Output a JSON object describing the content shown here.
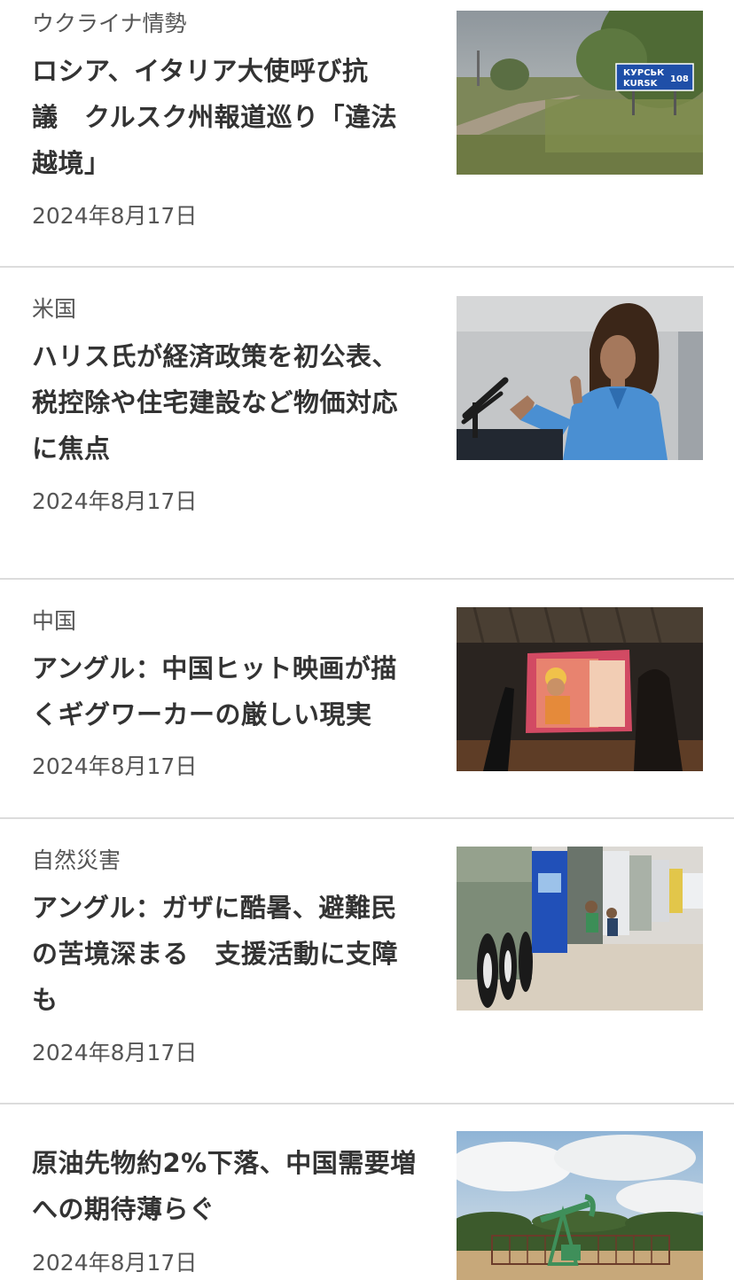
{
  "articles": [
    {
      "category": "ウクライナ情勢",
      "headline_lines": [
        "ロシア、イタリア大使呼び抗",
        "議　クルスク州報道巡り「違法",
        "越境」"
      ],
      "date": "2024年8月17日",
      "image": {
        "sign_line1": "КУРСЬК",
        "sign_line2": "KURSK",
        "sign_number": "108"
      }
    },
    {
      "category": "米国",
      "headline_lines": [
        "ハリス氏が経済政策を初公表、",
        "税控除や住宅建設など物価対応",
        "に焦点"
      ],
      "date": "2024年8月17日"
    },
    {
      "category": "中国",
      "headline_lines": [
        "アングル：中国ヒット映画が描",
        "くギグワーカーの厳しい現実"
      ],
      "date": "2024年8月17日"
    },
    {
      "category": "自然災害",
      "headline_lines": [
        "アングル：ガザに酷暑、避難民",
        "の苦境深まる　支援活動に支障",
        "も"
      ],
      "date": "2024年8月17日"
    },
    {
      "headline_lines": [
        "原油先物約2%下落、中国需要増",
        "への期待薄らぐ"
      ],
      "date": "2024年8月17日"
    }
  ]
}
